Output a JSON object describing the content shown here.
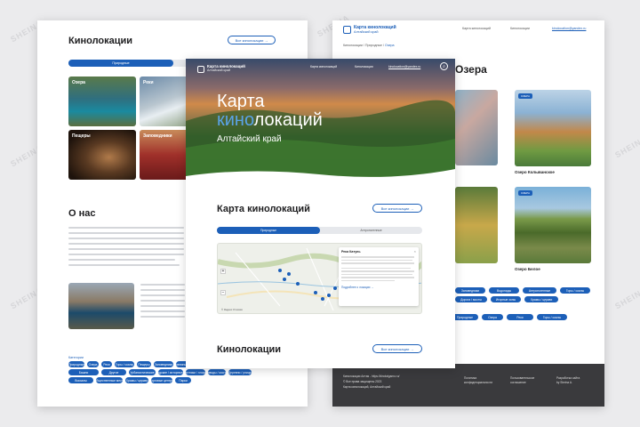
{
  "watermark": "SHEINA",
  "brand": {
    "title": "Карта кинолокаций",
    "subtitle": "Алтайский край",
    "email": "kinolocation@yandex.ru"
  },
  "nav": [
    "Карта кинолокаций",
    "Кинолокации"
  ],
  "left_page": {
    "heading": "Кинолокации",
    "all_button": "Все кинолокации →",
    "tab": "Природные",
    "cards": [
      "Озера",
      "Реки",
      "Пещеры",
      "Заповедники"
    ],
    "about_heading": "О нас",
    "categories_label": "Категории",
    "tags": [
      "Природные",
      "Озера",
      "Реки",
      "Горы / скалы",
      "Пещеры",
      "Заповедники",
      "Равнины / поля",
      "Курорты",
      "Сёла / деревни",
      "Башни",
      "Другое",
      "Урбанистические",
      "Городские / исторические",
      "Памятники / площади",
      "Заводы / мосты",
      "Деревни / улицы",
      "Вокзалы",
      "Общественные места",
      "Храмы / церкви",
      "Торговые центры",
      "Парки"
    ]
  },
  "right_page": {
    "breadcrumb": [
      "Кинолокации",
      "Природные",
      "Озера"
    ],
    "heading": "Озера",
    "badges": [
      "ОЗЕРА",
      "ОЗЕРА"
    ],
    "card_titles": [
      "Озеро Колыванское",
      "Озеро Белое"
    ],
    "tags": [
      "Заповедники",
      "Водопады",
      "Антропогенные",
      "Горы / скалы",
      "Дорога / мосты",
      "Игорные зоны",
      "Храмы / церкви"
    ],
    "footer": {
      "col1": [
        "Кинолокации Алтая - https://kinotaigamo.ru/",
        "© Все права защищены 2023",
        "Карта кинолокаций, Алтайский край"
      ],
      "col2": [
        "Политика",
        "конфиденциальности"
      ],
      "col3": [
        "Пользовательское",
        "соглашение"
      ],
      "col4": [
        "Разработка сайта",
        "by Sheina A."
      ]
    }
  },
  "center_page": {
    "hero_line1": "Карта",
    "hero_accent": "кино",
    "hero_rest": "локаций",
    "hero_sub": "Алтайский край",
    "map_heading": "Карта кинолокаций",
    "all_button": "Все кинолокации →",
    "tabs": [
      "Природные",
      "Антропогенные"
    ],
    "popup_title": "Река Катунь",
    "popup_link": "Подробнее о локации →",
    "map_attrib": "© Яндекс Условия",
    "bottom_heading": "Кинолокации",
    "bottom_button": "Все кинолокации →"
  },
  "colors": {
    "accent": "#1c5fb8",
    "hero_accent": "#5aa3e8",
    "footer_bg": "#3a3a3d"
  }
}
